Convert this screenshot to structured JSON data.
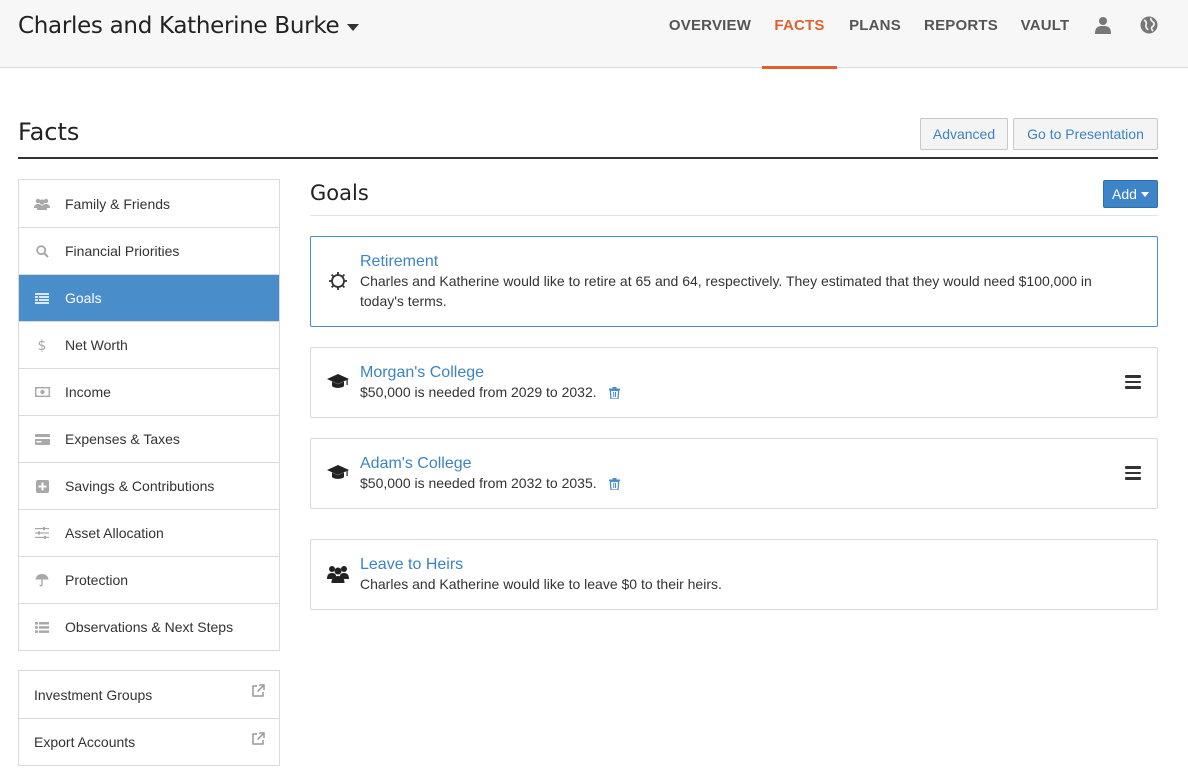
{
  "header": {
    "client_name": "Charles and Katherine Burke",
    "nav": [
      "OVERVIEW",
      "FACTS",
      "PLANS",
      "REPORTS",
      "VAULT"
    ],
    "active_nav": "FACTS",
    "icons": [
      "user-icon",
      "globe-icon"
    ]
  },
  "page": {
    "title": "Facts",
    "advanced_label": "Advanced",
    "presentation_label": "Go to Presentation"
  },
  "sidebar": {
    "items": [
      {
        "label": "Family & Friends",
        "icon": "users-icon"
      },
      {
        "label": "Financial Priorities",
        "icon": "search-icon"
      },
      {
        "label": "Goals",
        "icon": "list-icon",
        "active": true
      },
      {
        "label": "Net Worth",
        "icon": "dollar-icon"
      },
      {
        "label": "Income",
        "icon": "money-icon"
      },
      {
        "label": "Expenses & Taxes",
        "icon": "credit-card-icon"
      },
      {
        "label": "Savings & Contributions",
        "icon": "plus-square-icon"
      },
      {
        "label": "Asset Allocation",
        "icon": "sliders-icon"
      },
      {
        "label": "Protection",
        "icon": "umbrella-icon"
      },
      {
        "label": "Observations & Next Steps",
        "icon": "list-ul-icon"
      }
    ],
    "links": [
      {
        "label": "Investment Groups",
        "icon": "external-link-icon"
      },
      {
        "label": "Export Accounts",
        "icon": "external-link-icon"
      }
    ]
  },
  "goals": {
    "title": "Goals",
    "add_label": "Add",
    "cards": [
      {
        "title": "Retirement",
        "description": "Charles and Katherine would like to retire at 65 and 64, respectively. They estimated that they would need $100,000 in today's terms.",
        "icon": "sun-icon"
      },
      {
        "title": "Morgan's College",
        "description": "$50,000 is needed from 2029 to 2032.",
        "icon": "graduation-cap-icon"
      },
      {
        "title": "Adam's College",
        "description": "$50,000 is needed from 2032 to 2035.",
        "icon": "graduation-cap-icon"
      },
      {
        "title": "Leave to Heirs",
        "description": "Charles and Katherine would like to leave $0 to their heirs.",
        "icon": "users-icon"
      }
    ]
  },
  "colors": {
    "accent": "#e06030",
    "primary": "#3d84c2",
    "sidebar_active": "#4a8dcb"
  }
}
